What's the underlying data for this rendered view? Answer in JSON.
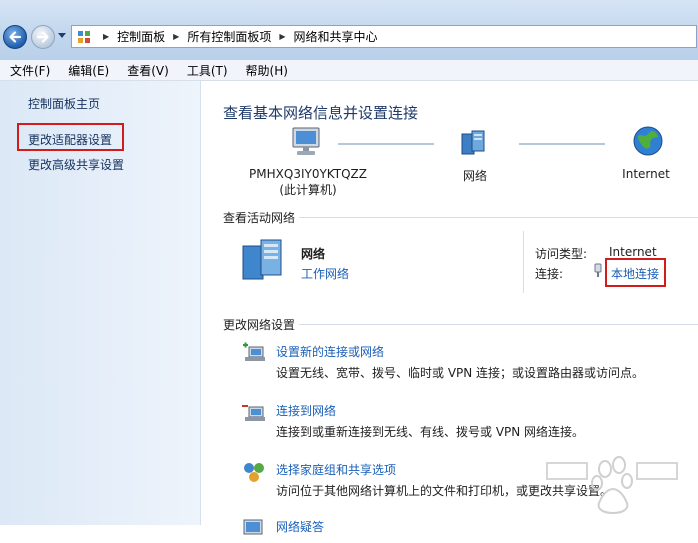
{
  "breadcrumb": [
    "控制面板",
    "所有控制面板项",
    "网络和共享中心"
  ],
  "menu": [
    "文件(F)",
    "编辑(E)",
    "查看(V)",
    "工具(T)",
    "帮助(H)"
  ],
  "left_pane": {
    "home": "控制面板主页",
    "adapter_settings": "更改适配器设置",
    "advanced_sharing": "更改高级共享设置"
  },
  "main": {
    "title": "查看基本网络信息并设置连接",
    "map": {
      "computer_name": "PMHXQ3IY0YKTQZZ",
      "computer_sub": "(此计算机)",
      "network": "网络",
      "internet": "Internet"
    },
    "active": {
      "header": "查看活动网络",
      "name": "网络",
      "type_link": "工作网络",
      "access_label": "访问类型:",
      "access_value": "Internet",
      "connection_label": "连接:",
      "connection_value": "本地连接"
    },
    "change": {
      "header": "更改网络设置",
      "tasks": [
        {
          "title": "设置新的连接或网络",
          "desc": "设置无线、宽带、拨号、临时或 VPN 连接；或设置路由器或访问点。"
        },
        {
          "title": "连接到网络",
          "desc": "连接到或重新连接到无线、有线、拨号或 VPN 网络连接。"
        },
        {
          "title": "选择家庭组和共享选项",
          "desc": "访问位于其他网络计算机上的文件和打印机，或更改共享设置。"
        },
        {
          "title": "网络疑答"
        }
      ]
    }
  },
  "colors": {
    "highlight": "#d21c1c",
    "link": "#1a5fb8",
    "title": "#1e3a69"
  }
}
